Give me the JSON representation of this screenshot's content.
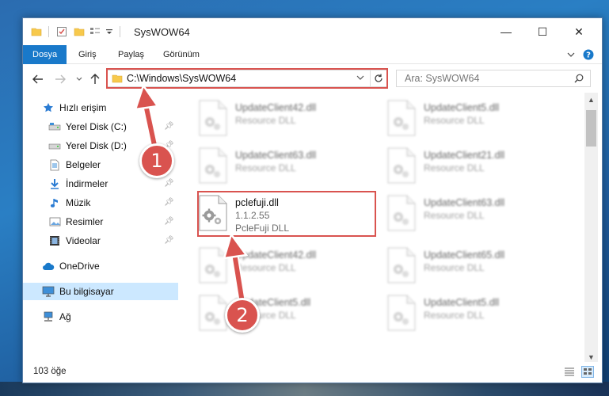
{
  "window": {
    "title": "SysWOW64",
    "minimize_glyph": "—",
    "maximize_glyph": "☐",
    "close_glyph": "✕"
  },
  "ribbon": {
    "tabs": [
      {
        "label": "Dosya",
        "active": true
      },
      {
        "label": "Giriş",
        "active": false
      },
      {
        "label": "Paylaş",
        "active": false
      },
      {
        "label": "Görünüm",
        "active": false
      }
    ]
  },
  "navigation": {
    "address": "C:\\Windows\\SysWOW64",
    "search_placeholder": "Ara: SysWOW64"
  },
  "sidebar": {
    "items": [
      {
        "label": "Hızlı erişim",
        "icon": "star-icon"
      },
      {
        "label": "Yerel Disk (C:)",
        "icon": "drive-icon",
        "pinned": true
      },
      {
        "label": "Yerel Disk (D:)",
        "icon": "drive-icon",
        "pinned": true
      },
      {
        "label": "Belgeler",
        "icon": "documents-icon",
        "pinned": true
      },
      {
        "label": "İndirmeler",
        "icon": "download-icon",
        "pinned": true
      },
      {
        "label": "Müzik",
        "icon": "music-icon",
        "pinned": true
      },
      {
        "label": "Resimler",
        "icon": "pictures-icon",
        "pinned": true
      },
      {
        "label": "Videolar",
        "icon": "videos-icon",
        "pinned": true
      },
      {
        "label": "OneDrive",
        "icon": "cloud-icon"
      },
      {
        "label": "Bu bilgisayar",
        "icon": "computer-icon",
        "selected": true
      },
      {
        "label": "Ağ",
        "icon": "network-icon"
      }
    ]
  },
  "files": {
    "left": [
      {
        "name": "UpdateClient42.dll",
        "sub": "Resource DLL"
      },
      {
        "name": "UpdateClient63.dll",
        "sub": "Resource DLL"
      },
      {
        "name": "pclefuji.dll",
        "version": "1.1.2.55",
        "sub": "PcleFuji DLL",
        "highlighted": true
      },
      {
        "name": "UpdateClient42.dll",
        "sub": "Resource DLL"
      },
      {
        "name": "UpdateClient5.dll",
        "sub": "Resource DLL"
      }
    ],
    "right": [
      {
        "name": "UpdateClient5.dll",
        "sub": "Resource DLL"
      },
      {
        "name": "UpdateClient21.dll",
        "sub": "Resource DLL"
      },
      {
        "name": "UpdateClient63.dll",
        "sub": "Resource DLL"
      },
      {
        "name": "UpdateClient65.dll",
        "sub": "Resource DLL"
      },
      {
        "name": "UpdateClient5.dll",
        "sub": "Resource DLL"
      }
    ]
  },
  "status": {
    "item_count": "103 öğe"
  },
  "annotations": {
    "step1": "1",
    "step2": "2",
    "color": "#d9534f"
  },
  "colors": {
    "accent": "#1979ca",
    "selection": "#cce8ff",
    "folder": "#f7c94c"
  }
}
